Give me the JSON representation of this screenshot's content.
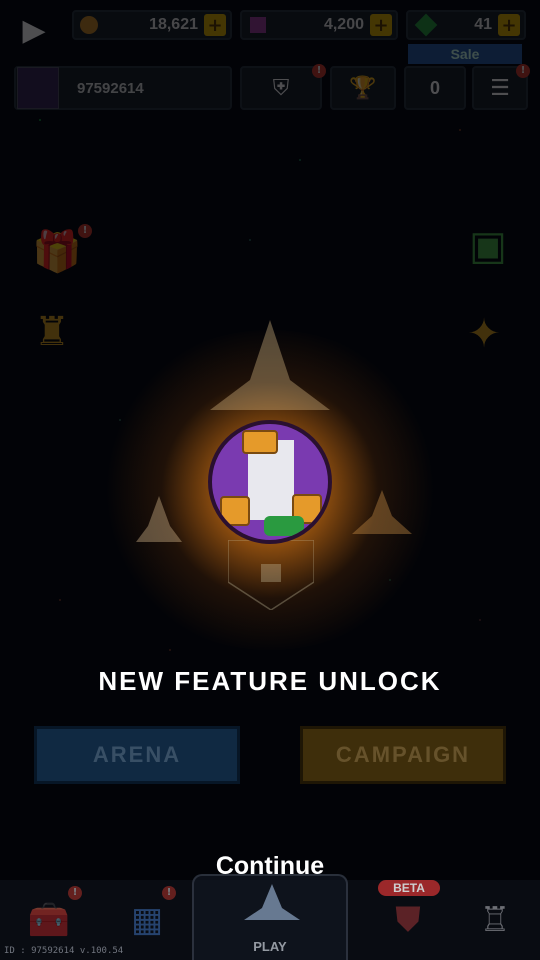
{
  "currencies": {
    "coins": "18,621",
    "gems": "4,200",
    "emeralds": "41",
    "plus": "+"
  },
  "sale_label": "Sale",
  "profile": {
    "id": "97592614"
  },
  "top_buttons": {
    "rank_badge": "!",
    "menu_badge": "!",
    "event_count": "0"
  },
  "side_items": {
    "left_badge": "!"
  },
  "popup": {
    "title": "NEW FEATURE UNLOCK",
    "arena": "ARENA",
    "campaign": "CAMPAIGN",
    "continue": "Continue"
  },
  "bottom_nav": {
    "shop_badge": "!",
    "hangar_badge": "!",
    "play": "PLAY",
    "beta": "BETA"
  },
  "footer": {
    "version": "ID : 97592614 v.100.54"
  },
  "colors": {
    "accent_gold": "#e0b000",
    "arena_blue": "#1e4f7e",
    "campaign_gold": "#7a5a10",
    "glow": "#ffbe3c"
  }
}
